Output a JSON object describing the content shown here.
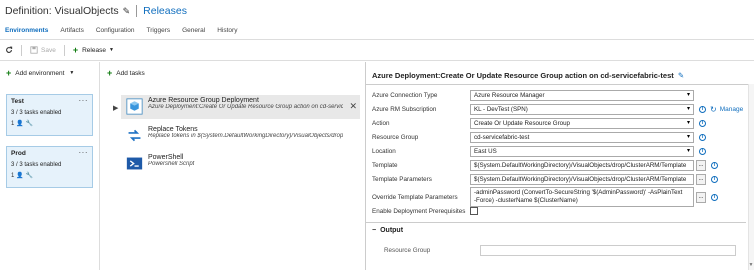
{
  "header": {
    "title": "Definition: VisualObjects",
    "releases_link": "Releases"
  },
  "tabs": [
    {
      "label": "Environments",
      "active": true
    },
    {
      "label": "Artifacts"
    },
    {
      "label": "Configuration"
    },
    {
      "label": "Triggers"
    },
    {
      "label": "General"
    },
    {
      "label": "History"
    }
  ],
  "toolbar": {
    "save_label": "Save",
    "release_label": "Release"
  },
  "environments": {
    "add_label": "Add environment",
    "items": [
      {
        "name": "Test",
        "status": "3 / 3 tasks enabled",
        "approvers": "1",
        "selected": true
      },
      {
        "name": "Prod",
        "status": "3 / 3 tasks enabled",
        "approvers": "1"
      }
    ]
  },
  "tasks": {
    "add_label": "Add tasks",
    "items": [
      {
        "name": "Azure Resource Group Deployment",
        "desc": "Azure Deployment:Create Or Update Resource Group action on cd-servicefabri",
        "icon": "azure-cube-icon",
        "selected": true
      },
      {
        "name": "Replace Tokens",
        "desc": "Replace tokens in $(System.DefaultWorkingDirectory)/VisualObjects/drop/SF",
        "icon": "tokens-arrows-icon"
      },
      {
        "name": "PowerShell",
        "desc": "Powershell Script",
        "icon": "powershell-icon"
      }
    ]
  },
  "panel": {
    "title": "Azure Deployment:Create Or Update Resource Group action on cd-servicefabric-test",
    "fields": {
      "connection_type": {
        "label": "Azure Connection Type",
        "value": "Azure Resource Manager"
      },
      "subscription": {
        "label": "Azure RM Subscription",
        "value": "KL - DevTest (SPN)",
        "manage": "Manage"
      },
      "action": {
        "label": "Action",
        "value": "Create Or Update Resource Group"
      },
      "resource_group": {
        "label": "Resource Group",
        "value": "cd-servicefabric-test"
      },
      "location": {
        "label": "Location",
        "value": "East US"
      },
      "template": {
        "label": "Template",
        "value": "$(System.DefaultWorkingDirectory)/VisualObjects/drop/ClusterARM/Template"
      },
      "template_params": {
        "label": "Template Parameters",
        "value": "$(System.DefaultWorkingDirectory)/VisualObjects/drop/ClusterARM/Template"
      },
      "override": {
        "label": "Override Template Parameters",
        "line1": "-adminPassword (ConvertTo-SecureString '$(AdminPassword)' -AsPlainText",
        "line2": "-Force) -clusterName $(ClusterName)"
      },
      "prereq": {
        "label": "Enable Deployment Prerequisites"
      }
    },
    "output": {
      "heading": "Output",
      "resource_group_label": "Resource Group"
    }
  },
  "colors": {
    "accent": "#106ebe",
    "green": "#107c10",
    "env_selected_bg": "#e6f2fb"
  }
}
